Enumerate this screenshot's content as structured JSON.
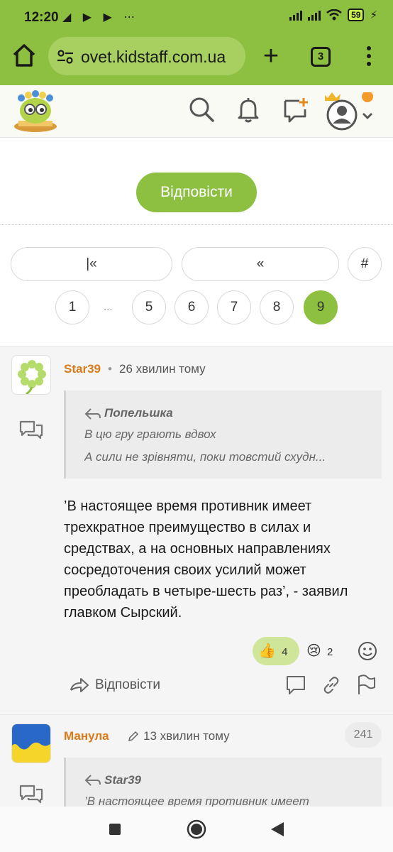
{
  "status_bar": {
    "time": "12:20",
    "notif_icons": "◢ ▶ ▶ ⋯",
    "battery": "59"
  },
  "browser": {
    "url": "ovet.kidstaff.com.ua",
    "tab_count": "3"
  },
  "thread": {
    "reply_button": "Відповісти",
    "pagination": {
      "first": "|«",
      "prev": "«",
      "jump": "#",
      "ellipsis": "...",
      "pages": [
        "1",
        "5",
        "6",
        "7",
        "8",
        "9"
      ],
      "current": "9"
    }
  },
  "posts": [
    {
      "author": "Star39",
      "separator": "•",
      "time": "26 хвилин тому",
      "quote": {
        "author": "Попельшка",
        "line1": "В цю гру грають вдвох",
        "line2": "А  сили  не  зрівняти,  поки  товстий  схудн..."
      },
      "body": "’В настоящее время противник имеет трехкратное преимущество в силах и средствах, а на основных направлениях сосредоточения своих усилий может преобладать в четыре-шесть раз’, - заявил главком Сырский.",
      "reactions": [
        {
          "emoji": "👍",
          "count": "4"
        },
        {
          "emoji": "😢",
          "count": "2"
        }
      ],
      "reply_label": "Відповісти"
    },
    {
      "author": "Манула",
      "time": "13 хвилин тому",
      "badge": "241",
      "quote": {
        "author": "Star39",
        "line1": "’В  настоящее  время  противник  имеет"
      }
    }
  ]
}
